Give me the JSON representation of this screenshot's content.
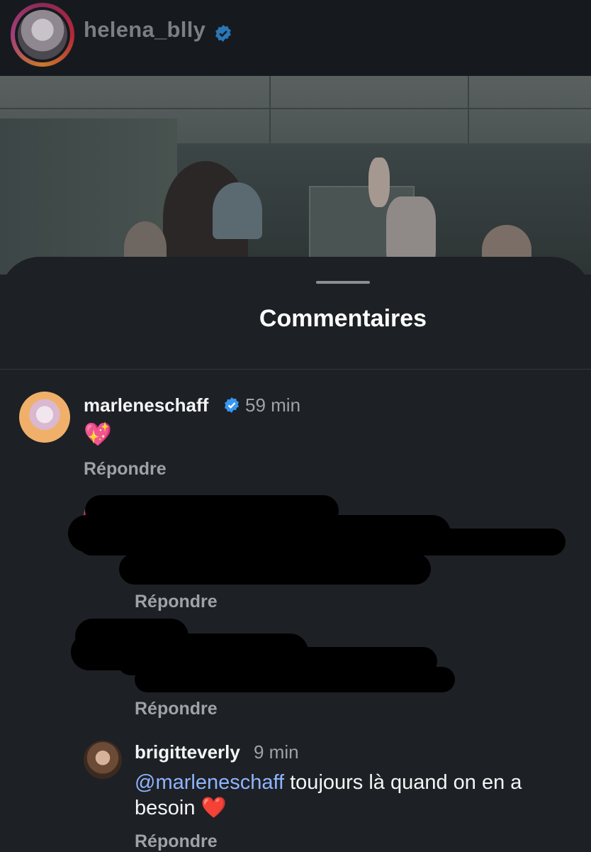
{
  "header": {
    "username": "helena_blly",
    "verified": true
  },
  "sheet": {
    "title": "Commentaires"
  },
  "comments": [
    {
      "username": "marleneschaff",
      "verified": true,
      "time": "59 min",
      "text": "💖",
      "reply_label": "Répondre"
    },
    {
      "redacted": true,
      "reply_label": "Répondre"
    },
    {
      "redacted": true,
      "reply_label": "Répondre"
    },
    {
      "username": "brigitteverly",
      "time": "9 min",
      "mention": "@marleneschaff",
      "text_line1": "toujours là quand on en a",
      "text_line2": "besoin",
      "heart": "❤️",
      "reply_label": "Répondre"
    }
  ],
  "colors": {
    "background": "#1d2024",
    "verified_blue": "#3897f0",
    "mention": "#8fb4ff",
    "muted": "#9ea3a9"
  }
}
